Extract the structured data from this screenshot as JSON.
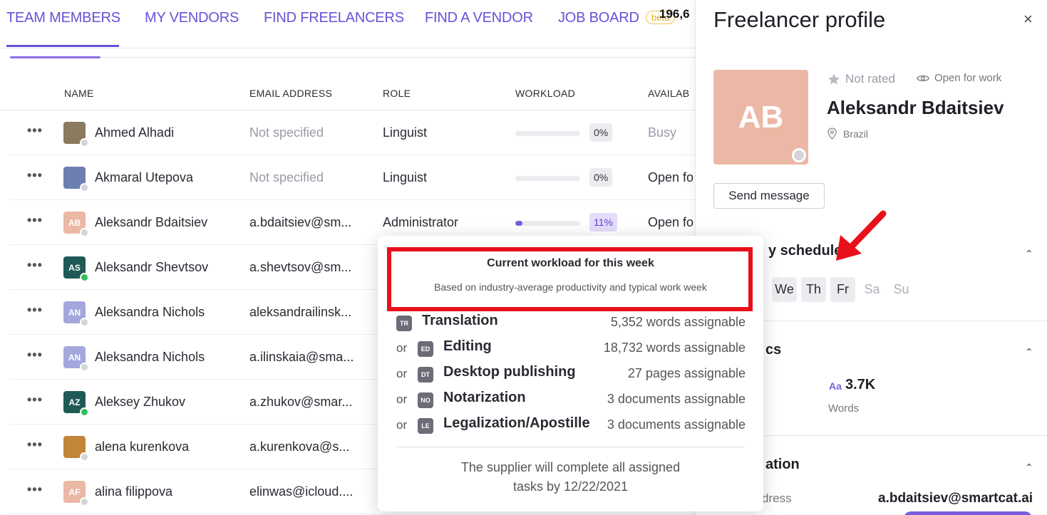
{
  "nav": {
    "tabs": [
      "TEAM MEMBERS",
      "MY VENDORS",
      "FIND FREELANCERS",
      "FIND A VENDOR",
      "JOB BOARD"
    ],
    "beta": "beta",
    "count": "196,6"
  },
  "table": {
    "headers": [
      "NAME",
      "EMAIL ADDRESS",
      "ROLE",
      "WORKLOAD",
      "AVAILAB"
    ],
    "rows": [
      {
        "initials": "",
        "avatar_color": "#8a7a5e",
        "name": "Ahmed Alhadi",
        "email": "Not specified",
        "email_muted": true,
        "role": "Linguist",
        "workload": 0,
        "pct": "0%",
        "avail": "Busy",
        "online": false
      },
      {
        "initials": "",
        "avatar_color": "#6d7fb0",
        "name": "Akmaral Utepova",
        "email": "Not specified",
        "email_muted": true,
        "role": "Linguist",
        "workload": 0,
        "pct": "0%",
        "avail": "Open fo",
        "online": false
      },
      {
        "initials": "AB",
        "avatar_color": "#ebb8a6",
        "name": "Aleksandr Bdaitsiev",
        "email": "a.bdaitsiev@sm...",
        "email_muted": false,
        "role": "Administrator",
        "workload": 11,
        "pct": "11%",
        "avail": "Open fo",
        "online": false
      },
      {
        "initials": "AS",
        "avatar_color": "#1f5a57",
        "name": "Aleksandr Shevtsov",
        "email": "a.shevtsov@sm...",
        "email_muted": false,
        "role": "",
        "workload": null,
        "pct": "",
        "avail": "",
        "online": true
      },
      {
        "initials": "AN",
        "avatar_color": "#a3a8dc",
        "name": "Aleksandra Nichols",
        "email": "aleksandrailinsk...",
        "email_muted": false,
        "role": "",
        "workload": null,
        "pct": "",
        "avail": "",
        "online": false
      },
      {
        "initials": "AN",
        "avatar_color": "#a3a8dc",
        "name": "Aleksandra Nichols",
        "email": "a.ilinskaia@sma...",
        "email_muted": false,
        "role": "",
        "workload": null,
        "pct": "",
        "avail": "",
        "online": false
      },
      {
        "initials": "AZ",
        "avatar_color": "#1f5a57",
        "name": "Aleksey Zhukov",
        "email": "a.zhukov@smar...",
        "email_muted": false,
        "role": "",
        "workload": null,
        "pct": "",
        "avail": "",
        "online": true
      },
      {
        "initials": "",
        "avatar_color": "#c2853a",
        "name": "alena kurenkova",
        "email": "a.kurenkova@s...",
        "email_muted": false,
        "role": "",
        "workload": null,
        "pct": "",
        "avail": "",
        "online": false
      },
      {
        "initials": "AF",
        "avatar_color": "#ebb8a6",
        "name": "alina filippova",
        "email": "elinwas@icloud....",
        "email_muted": false,
        "role": "",
        "workload": null,
        "pct": "",
        "avail": "",
        "online": false
      }
    ]
  },
  "popup": {
    "title": "Current workload for this week",
    "subtitle": "Based on industry-average productivity and typical work week",
    "services": [
      {
        "prefix": "",
        "code": "TR",
        "name": "Translation",
        "value": "5,352 words assignable"
      },
      {
        "prefix": "or",
        "code": "ED",
        "name": "Editing",
        "value": "18,732 words assignable"
      },
      {
        "prefix": "or",
        "code": "DT",
        "name": "Desktop publishing",
        "value": "27 pages assignable"
      },
      {
        "prefix": "or",
        "code": "NO",
        "name": "Notarization",
        "value": "3 documents assignable"
      },
      {
        "prefix": "or",
        "code": "LE",
        "name": "Legalization/Apostille",
        "value": "3 documents assignable"
      }
    ],
    "footer_line1": "The supplier will complete all assigned",
    "footer_line2": "tasks by 12/22/2021"
  },
  "panel": {
    "title": "Freelancer profile",
    "close": "×",
    "initials": "AB",
    "rating": "Not rated",
    "open_for_work": "Open for work",
    "name": "Aleksandr Bdaitsiev",
    "location": "Brazil",
    "send_message": "Send message",
    "schedule_title": "y schedule",
    "days": [
      {
        "label": "We",
        "on": true
      },
      {
        "label": "Th",
        "on": true
      },
      {
        "label": "Fr",
        "on": true
      },
      {
        "label": "Sa",
        "on": false
      },
      {
        "label": "Su",
        "on": false
      }
    ],
    "stats_title": "cs",
    "metric_icon": "Aa",
    "metric_value": "3.7K",
    "metric_label": "Words",
    "contact_title": "ation",
    "email_label": "dress",
    "email_value": "a.bdaitsiev@smartcat.ai"
  },
  "colors": {
    "accent": "#6b4fd8",
    "highlight_box": "#e8101a",
    "online": "#2fbf5a"
  }
}
